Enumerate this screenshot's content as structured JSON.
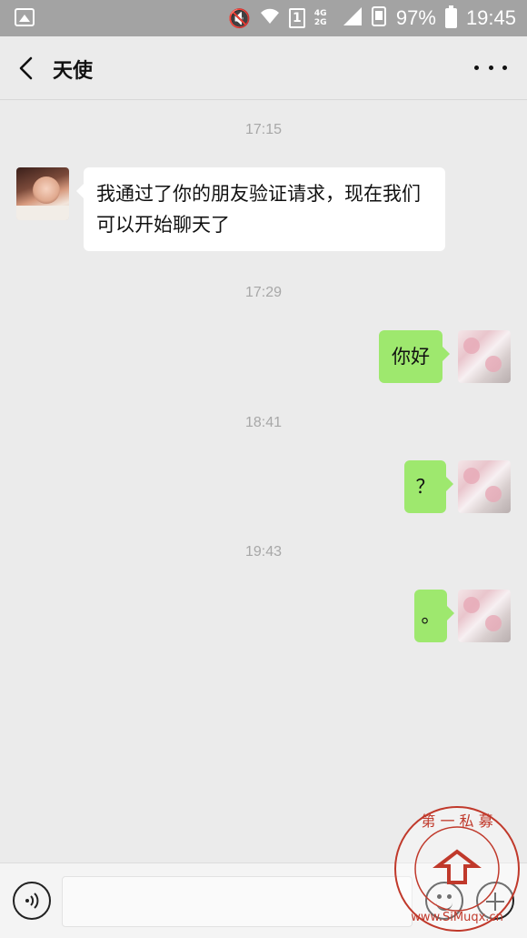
{
  "status_bar": {
    "battery_percent": "97%",
    "time": "19:45",
    "sim_slot": "1",
    "network": "4G 2G",
    "icons": [
      "image-icon",
      "mute-icon",
      "wifi-icon",
      "sim-icon",
      "signal-icon",
      "vibrate-icon",
      "battery-icon"
    ]
  },
  "header": {
    "title": "天使",
    "back_icon": "chevron-left-icon",
    "more_icon": "more-dots-icon"
  },
  "messages": [
    {
      "type": "timestamp",
      "text": "17:15"
    },
    {
      "type": "incoming",
      "text": "我通过了你的朋友验证请求，现在我们可以开始聊天了"
    },
    {
      "type": "timestamp",
      "text": "17:29"
    },
    {
      "type": "outgoing",
      "text": "你好"
    },
    {
      "type": "timestamp",
      "text": "18:41"
    },
    {
      "type": "outgoing",
      "text": "？"
    },
    {
      "type": "timestamp",
      "text": "19:43"
    },
    {
      "type": "outgoing",
      "text": "。"
    }
  ],
  "input_bar": {
    "value": "",
    "voice_icon": "voice-icon",
    "emoji_icon": "emoji-icon",
    "plus_icon": "plus-icon"
  },
  "watermark": {
    "text": "第一私募 www.SiMuqx.cn"
  },
  "colors": {
    "chat_background": "#ebebeb",
    "outgoing_bubble": "#9ee86e",
    "incoming_bubble": "#ffffff",
    "status_bar": "#a3a3a3",
    "timestamp_text": "#a7a7a7",
    "watermark": "#c0392b"
  }
}
